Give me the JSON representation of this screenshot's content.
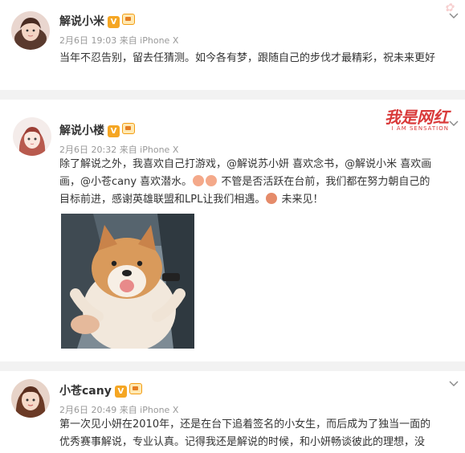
{
  "posts": [
    {
      "name": "解说小米",
      "verified_badge": "V",
      "meta": "2月6日 19:03 来自 iPhone X",
      "text": "当年不忍告别，留去任猜测。如今各有梦，跟随自己的步伐才最精彩，祝未来更好"
    },
    {
      "name": "解说小楼",
      "verified_badge": "V",
      "meta": "2月6日 20:32 来自 iPhone X",
      "line1": "除了解说之外，我喜欢自己打游戏，@解说苏小妍 喜欢念书，@解说小米 喜欢画",
      "line2a": "画，@小苍cany 喜欢潜水。",
      "line2b": "不管是否活跃在台前，我们都在努力朝自己的",
      "line3a": "目标前进，感谢英雄联盟和LPL让我们相遇。",
      "line3b": "未来见！",
      "watermark_main": "我是网红",
      "watermark_sub": "I AM SENSATION"
    },
    {
      "name": "小苍cany",
      "verified_badge": "V",
      "meta": "2月6日 20:49 来自 iPhone X",
      "line1": "第一次见小妍在2010年，还是在台下追着签名的小女生，而后成为了独当一面的",
      "line2": "优秀赛事解说，专业认真。记得我还是解说的时候，和小妍畅谈彼此的理想，没"
    }
  ],
  "icons": [
    "avatar",
    "verified-badge",
    "vip-badge",
    "chevron-down-icon",
    "emoji-icon"
  ]
}
